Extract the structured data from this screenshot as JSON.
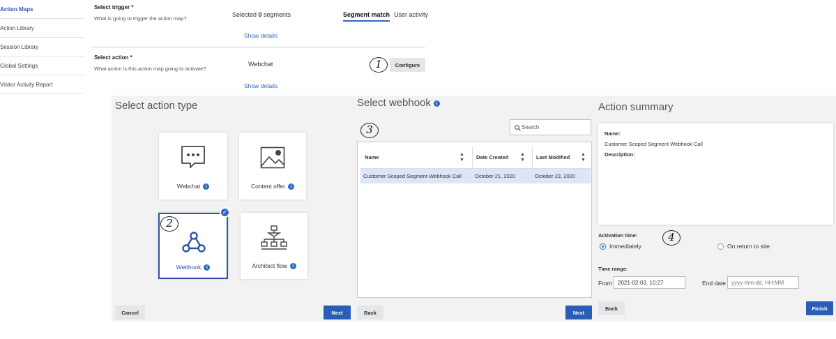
{
  "nav": {
    "items": [
      "Action Maps",
      "Action Library",
      "Session Library",
      "Global Settings",
      "Visitor Activity Report"
    ]
  },
  "trigger": {
    "label": "Select trigger *",
    "description": "What is going to trigger the action map?",
    "selected_prefix": "Selected ",
    "selected_count": "0",
    "selected_suffix": " segments",
    "tabs": [
      "Segment match",
      "User activity"
    ],
    "show_details": "Show details"
  },
  "action": {
    "label": "Select action *",
    "description": "What action is this action map going to activate?",
    "value": "Webchat",
    "configure": "Configure",
    "show_details": "Show details"
  },
  "steps": [
    "1",
    "2",
    "3",
    "4"
  ],
  "action_type": {
    "title": "Select action type",
    "cards": [
      {
        "label": "Webchat",
        "icon": "chat-bubble-icon"
      },
      {
        "label": "Content offer",
        "icon": "image-icon"
      },
      {
        "label": "Webhook",
        "icon": "webhook-icon",
        "selected": true
      },
      {
        "label": "Architect flow",
        "icon": "flow-icon"
      }
    ],
    "cancel": "Cancel",
    "next": "Next",
    "check": "✓"
  },
  "webhook": {
    "title": "Select webhook",
    "info": "i",
    "search_placeholder": "Search",
    "columns": [
      "Name",
      "Date Created",
      "Last Modified"
    ],
    "rows": [
      {
        "name": "Customer Scoped Segment Webhook Call",
        "created": "October 21, 2020",
        "modified": "October 23, 2020"
      }
    ],
    "back": "Back",
    "next": "Next"
  },
  "summary": {
    "title": "Action summary",
    "name_label": "Name:",
    "name_value": "Customer Scoped Segment Webhook Call",
    "description_label": "Description:",
    "activation_label": "Activation time:",
    "opt_immediately": "Immediately",
    "opt_return": "On return to site",
    "time_range_label": "Time range:",
    "from_label": "From",
    "from_value": "2021-02-03, 10:27",
    "end_label": "End date",
    "end_placeholder": "yyyy-mm-dd, HH:MM",
    "back": "Back",
    "finish": "Finish"
  },
  "colors": {
    "accent": "#2e68c0",
    "primary_button": "#2a5db8",
    "panel_bg": "#f2f2f2"
  }
}
